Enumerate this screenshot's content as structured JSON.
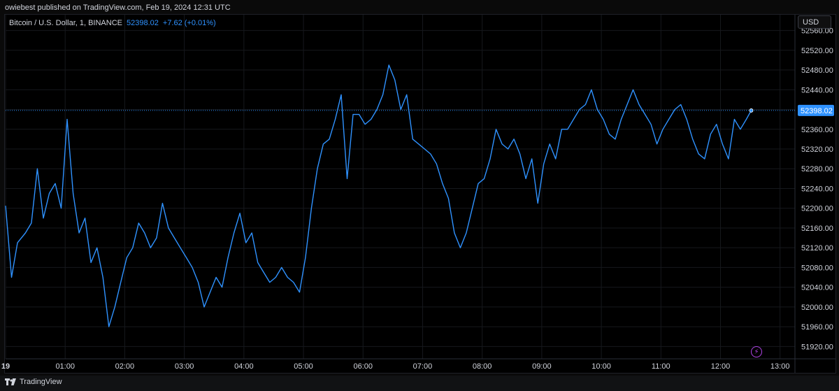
{
  "header": {
    "published_text": "owiebest published on TradingView.com, Feb 19, 2024 12:31 UTC"
  },
  "legend": {
    "symbol": "Bitcoin / U.S. Dollar, 1, BINANCE",
    "price": "52398.02",
    "change": "+7.62 (+0.01%)"
  },
  "currency_button": "USD",
  "footer": {
    "brand": "TradingView"
  },
  "colors": {
    "line": "#2f92ff",
    "grid": "#16181d",
    "price_label_bg": "#2f92ff",
    "bolt": "#b045e6"
  },
  "icons": [
    "tradingview-logo-icon",
    "lightning-icon"
  ],
  "chart_data": {
    "type": "line",
    "title": "",
    "xlabel": "",
    "ylabel": "",
    "x_ticks": [
      "19",
      "01:00",
      "02:00",
      "03:00",
      "04:00",
      "05:00",
      "06:00",
      "07:00",
      "08:00",
      "09:00",
      "10:00",
      "11:00",
      "12:00",
      "13:00"
    ],
    "y_ticks": [
      51920,
      51960,
      52000,
      52040,
      52080,
      52120,
      52160,
      52200,
      52240,
      52280,
      52320,
      52360,
      52400,
      52440,
      52480,
      52520,
      52560
    ],
    "y_tick_labels": [
      "51920.00",
      "51960.00",
      "52000.00",
      "52040.00",
      "52080.00",
      "52120.00",
      "52160.00",
      "52200.00",
      "52240.00",
      "52280.00",
      "52320.00",
      "52360.00",
      "52400.00",
      "52440.00",
      "52480.00",
      "52520.00",
      "52560.00"
    ],
    "ylim": [
      51895,
      52592
    ],
    "xlim": [
      "00:00",
      "13:15"
    ],
    "last_price_label": "52398.02",
    "last_price": 52398.02,
    "grid": true,
    "series": [
      {
        "name": "",
        "x": [
          "00:00",
          "00:06",
          "00:12",
          "00:20",
          "00:26",
          "00:32",
          "00:38",
          "00:44",
          "00:50",
          "00:56",
          "01:02",
          "01:08",
          "01:14",
          "01:20",
          "01:26",
          "01:32",
          "01:38",
          "01:44",
          "01:50",
          "01:56",
          "02:02",
          "02:08",
          "02:14",
          "02:20",
          "02:26",
          "02:32",
          "02:38",
          "02:44",
          "02:50",
          "02:56",
          "03:02",
          "03:08",
          "03:14",
          "03:20",
          "03:26",
          "03:32",
          "03:38",
          "03:44",
          "03:50",
          "03:56",
          "04:02",
          "04:08",
          "04:14",
          "04:20",
          "04:26",
          "04:32",
          "04:38",
          "04:44",
          "04:50",
          "04:56",
          "05:02",
          "05:08",
          "05:14",
          "05:20",
          "05:26",
          "05:32",
          "05:38",
          "05:44",
          "05:50",
          "05:56",
          "06:02",
          "06:08",
          "06:14",
          "06:20",
          "06:26",
          "06:32",
          "06:38",
          "06:44",
          "06:50",
          "06:56",
          "07:02",
          "07:08",
          "07:14",
          "07:20",
          "07:26",
          "07:32",
          "07:38",
          "07:44",
          "07:50",
          "07:56",
          "08:02",
          "08:08",
          "08:14",
          "08:20",
          "08:26",
          "08:32",
          "08:38",
          "08:44",
          "08:50",
          "08:56",
          "09:02",
          "09:08",
          "09:14",
          "09:20",
          "09:26",
          "09:32",
          "09:38",
          "09:44",
          "09:50",
          "09:56",
          "10:02",
          "10:08",
          "10:14",
          "10:20",
          "10:26",
          "10:32",
          "10:38",
          "10:44",
          "10:50",
          "10:56",
          "11:02",
          "11:08",
          "11:14",
          "11:20",
          "11:26",
          "11:32",
          "11:38",
          "11:44",
          "11:50",
          "11:56",
          "12:02",
          "12:08",
          "12:14",
          "12:20",
          "12:26",
          "12:31"
        ],
        "values": [
          52205,
          52060,
          52130,
          52150,
          52170,
          52280,
          52180,
          52230,
          52250,
          52200,
          52380,
          52230,
          52150,
          52180,
          52090,
          52120,
          52060,
          51960,
          52000,
          52050,
          52100,
          52120,
          52170,
          52150,
          52120,
          52140,
          52210,
          52160,
          52140,
          52120,
          52100,
          52080,
          52050,
          52000,
          52030,
          52060,
          52040,
          52100,
          52150,
          52190,
          52130,
          52150,
          52090,
          52070,
          52050,
          52060,
          52080,
          52060,
          52050,
          52030,
          52100,
          52200,
          52280,
          52330,
          52340,
          52380,
          52430,
          52260,
          52390,
          52390,
          52370,
          52380,
          52400,
          52430,
          52490,
          52460,
          52400,
          52430,
          52340,
          52330,
          52320,
          52310,
          52290,
          52250,
          52220,
          52150,
          52120,
          52150,
          52200,
          52250,
          52260,
          52300,
          52360,
          52330,
          52320,
          52340,
          52310,
          52260,
          52300,
          52210,
          52290,
          52330,
          52300,
          52360,
          52360,
          52380,
          52400,
          52410,
          52440,
          52400,
          52380,
          52350,
          52340,
          52380,
          52410,
          52440,
          52410,
          52390,
          52370,
          52330,
          52360,
          52380,
          52400,
          52410,
          52380,
          52340,
          52310,
          52300,
          52350,
          52370,
          52330,
          52300,
          52380,
          52360,
          52380,
          52398
        ]
      }
    ]
  }
}
